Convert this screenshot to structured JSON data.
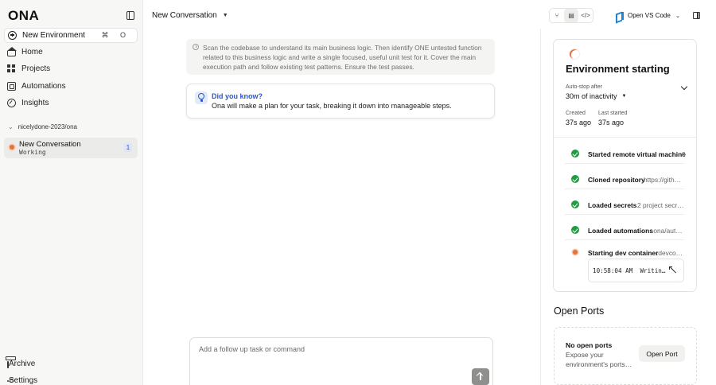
{
  "app": {
    "logo": "ONA"
  },
  "sidebar": {
    "new_env": {
      "label": "New Environment",
      "shortcut": "⌘ O"
    },
    "nav": [
      {
        "label": "Home"
      },
      {
        "label": "Projects"
      },
      {
        "label": "Automations"
      },
      {
        "label": "Insights"
      }
    ],
    "group": {
      "label": "nicelydone-2023/ona"
    },
    "conversation": {
      "title": "New Conversation",
      "status": "Working",
      "badge": "1"
    },
    "bottom": [
      {
        "label": "Archive"
      },
      {
        "label": "Settings"
      }
    ]
  },
  "header": {
    "title": "New Conversation",
    "toolbar_icons": [
      "git-branch-icon",
      "document-icon",
      "code-icon"
    ],
    "vscode_label": "Open VS Code"
  },
  "chat": {
    "task_text": "Scan the codebase to understand its main business logic. Then identify ONE untested function related to this business logic and write a single focused, useful unit test for it. Cover the main execution path and follow existing test patterns. Ensure the test passes.",
    "tip": {
      "title": "Did you know?",
      "body": "Ona will make a plan for your task, breaking it down into manageable steps."
    },
    "input_placeholder": "Add a follow up task or command"
  },
  "environment": {
    "title": "Environment starting",
    "autostop_label": "Auto-stop after",
    "autostop_value": "30m of inactivity",
    "created_label": "Created",
    "created_value": "37s ago",
    "last_started_label": "Last started",
    "last_started_value": "37s ago",
    "steps": [
      {
        "name": "Started remote virtual machine",
        "detail": "0",
        "state": "done"
      },
      {
        "name": "Cloned repository",
        "detail": "https://gith…",
        "state": "done"
      },
      {
        "name": "Loaded secrets",
        "detail": "2 project secr…",
        "state": "done"
      },
      {
        "name": "Loaded automations",
        "detail": ".ona/aut…",
        "state": "done"
      },
      {
        "name": "Starting dev container",
        "detail": ".devco…",
        "state": "running"
      }
    ],
    "log": {
      "time": "10:58:04 AM",
      "message": "Writin…"
    },
    "colors": {
      "success": "#1f9d3f",
      "running": "#e8713a",
      "accent": "#2d56c9"
    }
  },
  "ports": {
    "title": "Open Ports",
    "empty_title": "No open ports",
    "empty_body": "Expose your environment's ports…",
    "button": "Open Port"
  }
}
